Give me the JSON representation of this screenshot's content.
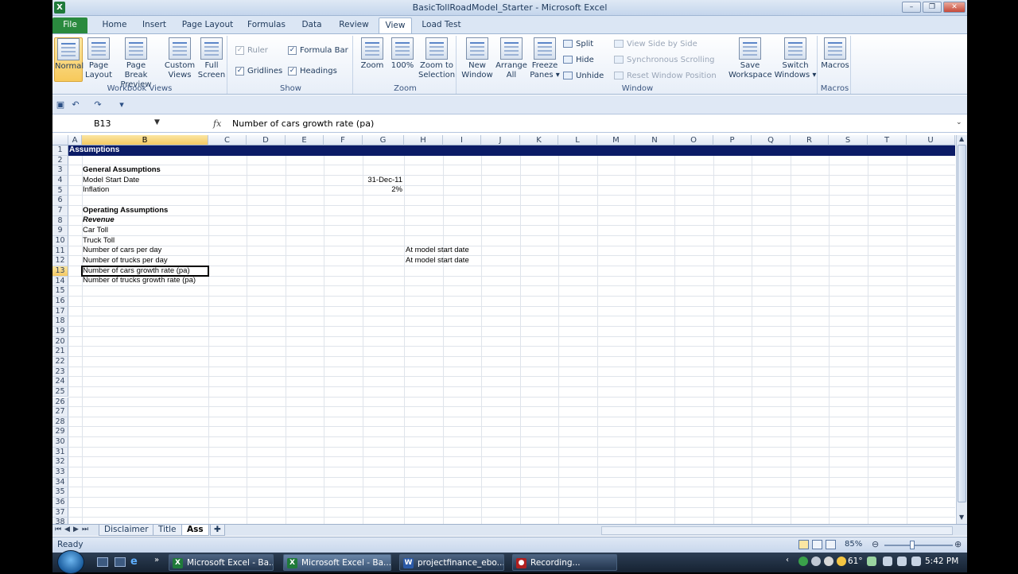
{
  "window": {
    "title": "BasicTollRoadModel_Starter - Microsoft Excel",
    "min": "–",
    "max": "❐",
    "close": "✕"
  },
  "tabs": [
    "File",
    "Home",
    "Insert",
    "Page Layout",
    "Formulas",
    "Data",
    "Review",
    "View",
    "Load Test"
  ],
  "ribbon": {
    "workbook_views": {
      "label": "Workbook Views",
      "normal": "Normal",
      "page_layout": "Page Layout",
      "page_break": "Page Break Preview",
      "custom_views": "Custom Views",
      "full_screen": "Full Screen"
    },
    "show": {
      "label": "Show",
      "ruler": "Ruler",
      "formula_bar": "Formula Bar",
      "gridlines": "Gridlines",
      "headings": "Headings"
    },
    "zoom": {
      "label": "Zoom",
      "zoom": "Zoom",
      "hundred": "100%",
      "to_selection": "Zoom to Selection"
    },
    "window": {
      "label": "Window",
      "new_window": "New Window",
      "arrange_all": "Arrange All",
      "freeze": "Freeze Panes ▾",
      "split": "Split",
      "hide": "Hide",
      "unhide": "Unhide",
      "side_by_side": "View Side by Side",
      "sync_scroll": "Synchronous Scrolling",
      "reset_pos": "Reset Window Position",
      "save_ws": "Save Workspace",
      "switch": "Switch Windows ▾"
    },
    "macros": {
      "label": "Macros",
      "macros": "Macros"
    }
  },
  "formula_bar": {
    "name_box": "B13",
    "fx": "fx",
    "content": "Number of cars growth rate (pa)"
  },
  "columns": [
    "A",
    "B",
    "C",
    "D",
    "E",
    "F",
    "G",
    "H",
    "I",
    "J",
    "K",
    "L",
    "M",
    "N",
    "O",
    "P",
    "Q",
    "R",
    "S",
    "T",
    "U"
  ],
  "rows": [
    "1",
    "2",
    "3",
    "4",
    "5",
    "6",
    "7",
    "8",
    "9",
    "10",
    "11",
    "12",
    "13",
    "14",
    "15",
    "16",
    "17",
    "18",
    "19",
    "20",
    "21",
    "22",
    "23",
    "24",
    "25",
    "26",
    "27",
    "28",
    "29",
    "30",
    "31",
    "32",
    "33",
    "34",
    "35",
    "36",
    "37",
    "38"
  ],
  "cells": {
    "banner": "Assumptions",
    "general": "General Assumptions",
    "model_start": "Model Start Date",
    "model_start_val": "31-Dec-11",
    "inflation": "Inflation",
    "inflation_val": "2%",
    "operating": "Operating Assumptions",
    "revenue": "Revenue",
    "car_toll": "Car Toll",
    "truck_toll": "Truck Toll",
    "cars_per_day": "Number of cars per day",
    "cars_note": "At model start date",
    "trucks_per_day": "Number of trucks per day",
    "trucks_note": "At model start date",
    "cars_growth": "Number of cars growth rate (pa)",
    "trucks_growth": "Number of trucks growth rate (pa)"
  },
  "sheets": [
    "Disclaimer",
    "Title",
    "Ass"
  ],
  "status": {
    "ready": "Ready",
    "zoom": "85%"
  },
  "taskbar": {
    "items": [
      "Microsoft Excel - Ba...",
      "Microsoft Excel - Ba...",
      "projectfinance_ebo...",
      "Recording..."
    ],
    "temp": "61°",
    "clock": "5:42 PM"
  },
  "colors": {
    "banner": "#0b1b66",
    "file_tab": "#2a8a3e",
    "selected_header": "#f4c862"
  }
}
